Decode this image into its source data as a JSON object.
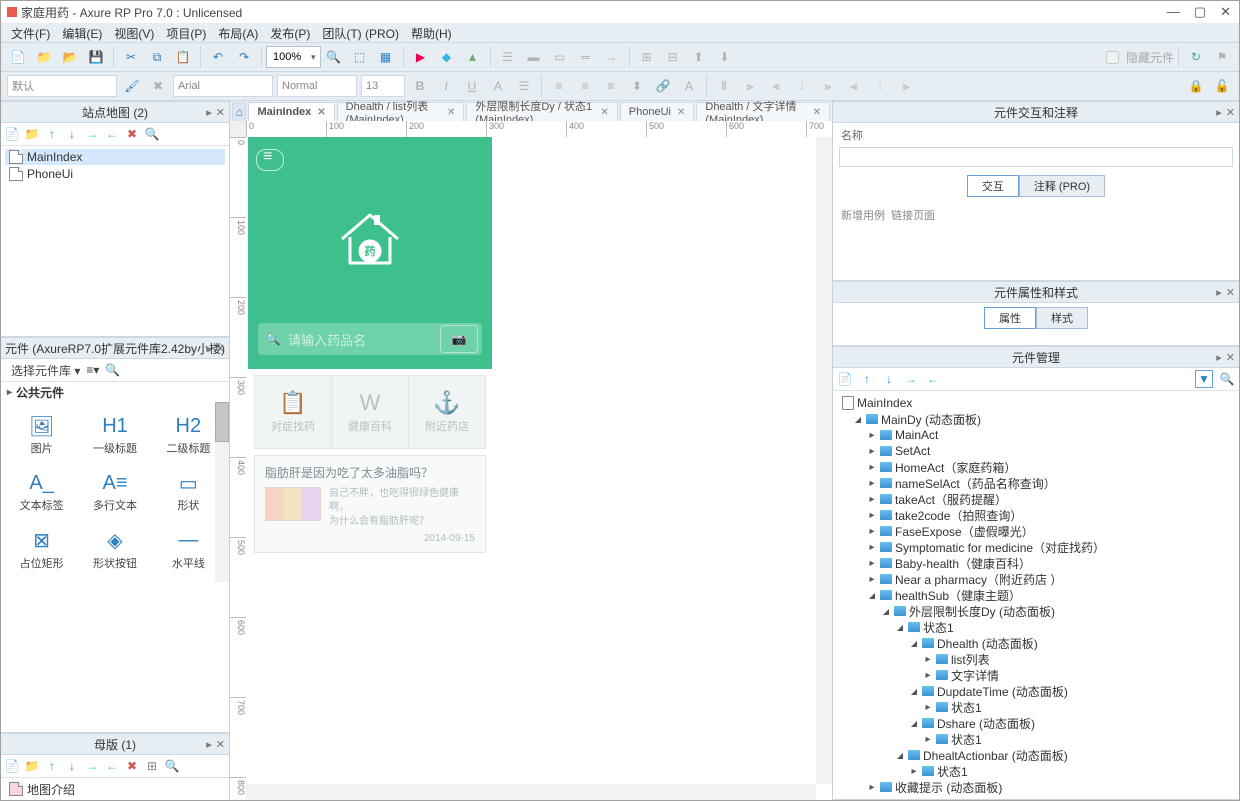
{
  "app": {
    "title": "家庭用药 - Axure RP Pro 7.0 : Unlicensed"
  },
  "window_controls": {
    "min": "—",
    "max": "▢",
    "close": "✕"
  },
  "menus": [
    "文件(F)",
    "编辑(E)",
    "视图(V)",
    "项目(P)",
    "布局(A)",
    "发布(P)",
    "团队(T) (PRO)",
    "帮助(H)"
  ],
  "toolbar": {
    "zoom": "100%",
    "hide_widgets": "隐藏元件"
  },
  "formatting": {
    "font": "Arial",
    "style": "Normal",
    "size": "13"
  },
  "sitemap": {
    "title": "站点地图 (2)",
    "items": [
      {
        "label": "MainIndex",
        "selected": true
      },
      {
        "label": "PhoneUi",
        "selected": false
      }
    ]
  },
  "widgets_panel": {
    "title": "元件 (AxureRP7.0扩展元件库2.42by小楼)",
    "selector": "选择元件库",
    "category": "公共元件",
    "cells": [
      {
        "glyph": "🖼",
        "label": "图片"
      },
      {
        "glyph": "H1",
        "label": "一级标题"
      },
      {
        "glyph": "H2",
        "label": "二级标题"
      },
      {
        "glyph": "A_",
        "label": "文本标签"
      },
      {
        "glyph": "A≡",
        "label": "多行文本"
      },
      {
        "glyph": "▭",
        "label": "形状"
      },
      {
        "glyph": "⊠",
        "label": "占位矩形"
      },
      {
        "glyph": "◈",
        "label": "形状按钮"
      },
      {
        "glyph": "—",
        "label": "水平线"
      }
    ]
  },
  "masters": {
    "title": "母版 (1)",
    "items": [
      {
        "label": "地图介绍"
      }
    ]
  },
  "tabs": [
    {
      "label": "MainIndex",
      "active": true
    },
    {
      "label": "Dhealth / list列表 (MainIndex)",
      "active": false
    },
    {
      "label": "外层限制长度Dy / 状态1 (MainIndex)",
      "active": false
    },
    {
      "label": "PhoneUi",
      "active": false
    },
    {
      "label": "Dhealth / 文字详情 (MainIndex)",
      "active": false
    }
  ],
  "ruler_h": [
    "0",
    "100",
    "200",
    "300",
    "400",
    "500",
    "600",
    "700"
  ],
  "ruler_v": [
    "0",
    "100",
    "200",
    "300",
    "400",
    "500",
    "600",
    "700",
    "800"
  ],
  "phone": {
    "search_placeholder": "请输入药品名",
    "slots": [
      {
        "glyph": "📋",
        "label": "对症找药"
      },
      {
        "glyph": "W",
        "label": "健康百科"
      },
      {
        "glyph": "⚓",
        "label": "附近药店"
      }
    ],
    "article_title": "脂肪肝是因为吃了太多油脂吗？",
    "article_desc": "自己不胖，也吃得很绿色健康啊，\n为什么会有脂肪肝呢？",
    "article_date": "2014-09-15"
  },
  "interactions_panel": {
    "title": "元件交互和注释",
    "name_label": "名称",
    "tab_interact": "交互",
    "tab_notes": "注释 (PRO)",
    "add_case": "新增用例",
    "link_page": "链接页面"
  },
  "props_panel": {
    "title": "元件属性和样式",
    "tab_props": "属性",
    "tab_styles": "样式"
  },
  "mgr_panel": {
    "title": "元件管理",
    "root": "MainIndex",
    "tree": [
      {
        "d": 0,
        "o": true,
        "t": "MainDy (动态面板)"
      },
      {
        "d": 1,
        "o": false,
        "t": "MainAct"
      },
      {
        "d": 1,
        "o": false,
        "t": "SetAct"
      },
      {
        "d": 1,
        "o": false,
        "t": "HomeAct（家庭药箱）"
      },
      {
        "d": 1,
        "o": false,
        "t": "nameSelAct（药品名称查询）"
      },
      {
        "d": 1,
        "o": false,
        "t": "takeAct（服药提醒）"
      },
      {
        "d": 1,
        "o": false,
        "t": "take2code（拍照查询）"
      },
      {
        "d": 1,
        "o": false,
        "t": "FaseExpose（虚假曝光）"
      },
      {
        "d": 1,
        "o": false,
        "t": "Symptomatic for medicine（对症找药）"
      },
      {
        "d": 1,
        "o": false,
        "t": "Baby-health（健康百科）"
      },
      {
        "d": 1,
        "o": false,
        "t": "Near a pharmacy（附近药店 ）"
      },
      {
        "d": 1,
        "o": true,
        "t": "healthSub（健康主题）"
      },
      {
        "d": 2,
        "o": true,
        "t": "外层限制长度Dy (动态面板)"
      },
      {
        "d": 3,
        "o": true,
        "t": "状态1"
      },
      {
        "d": 4,
        "o": true,
        "t": "Dhealth (动态面板)"
      },
      {
        "d": 5,
        "o": false,
        "t": "list列表"
      },
      {
        "d": 5,
        "o": false,
        "t": "文字详情",
        "leaf": true
      },
      {
        "d": 4,
        "o": true,
        "t": "DupdateTime (动态面板)"
      },
      {
        "d": 5,
        "o": false,
        "t": "状态1"
      },
      {
        "d": 4,
        "o": true,
        "t": "Dshare (动态面板)"
      },
      {
        "d": 5,
        "o": false,
        "t": "状态1"
      },
      {
        "d": 3,
        "o": true,
        "t": "DhealtActionbar (动态面板)"
      },
      {
        "d": 4,
        "o": false,
        "t": "状态1"
      },
      {
        "d": 1,
        "o": false,
        "t": "收藏提示 (动态面板)"
      }
    ]
  }
}
